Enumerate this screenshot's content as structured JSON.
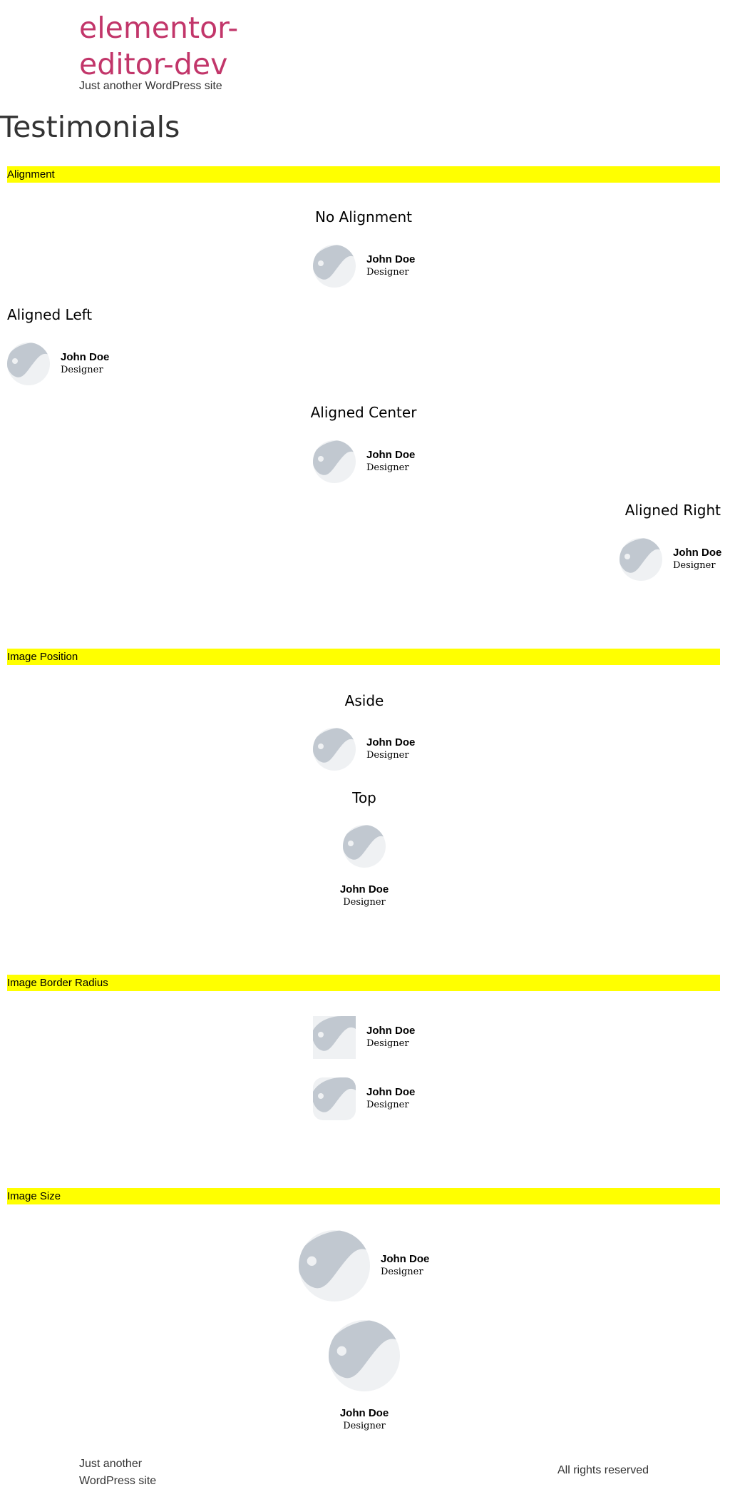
{
  "site": {
    "title": "elementor-editor-dev",
    "description": "Just another WordPress site"
  },
  "page": {
    "title": "Testimonials"
  },
  "sections": {
    "alignment": "Alignment",
    "image_position": "Image Position",
    "image_border_radius": "Image Border Radius",
    "image_size": "Image Size"
  },
  "headings": {
    "no_alignment": "No Alignment",
    "aligned_left": "Aligned Left",
    "aligned_center": "Aligned Center",
    "aligned_right": "Aligned Right",
    "aside": "Aside",
    "top": "Top"
  },
  "testimonial": {
    "name": "John Doe",
    "job": "Designer",
    "image_icon": "image-placeholder-icon"
  },
  "footer": {
    "description": "Just another WordPress site",
    "rights": "All rights reserved"
  },
  "colors": {
    "site_title": "#c2366a",
    "section_bar": "#ffff00",
    "placeholder_bg": "#eff1f3",
    "placeholder_fg": "#c1c8d0"
  }
}
